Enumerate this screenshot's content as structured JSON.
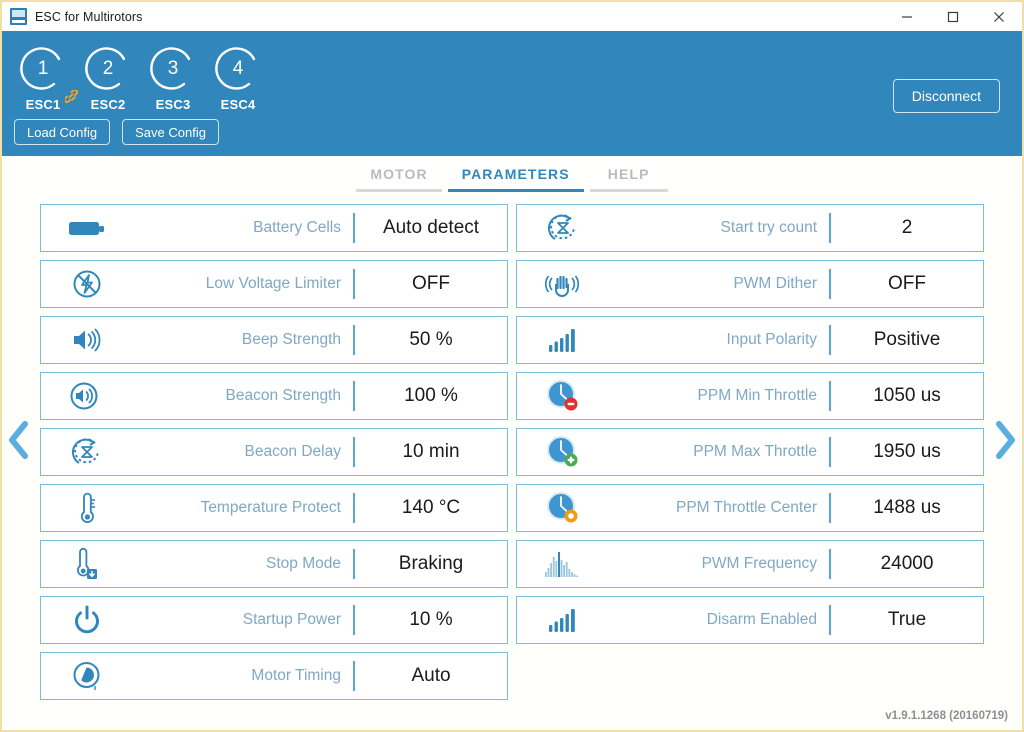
{
  "window": {
    "title": "ESC for Multirotors",
    "app_icon": "app-icon",
    "controls": {
      "minimize": "minimize-icon",
      "maximize": "maximize-icon",
      "close": "close-icon"
    }
  },
  "header": {
    "esc_units": [
      {
        "number": "1",
        "label": "ESC1",
        "linked": true
      },
      {
        "number": "2",
        "label": "ESC2",
        "linked": false
      },
      {
        "number": "3",
        "label": "ESC3",
        "linked": false
      },
      {
        "number": "4",
        "label": "ESC4",
        "linked": false
      }
    ],
    "load_config_label": "Load Config",
    "save_config_label": "Save Config",
    "disconnect_label": "Disconnect",
    "background_color": "#3187bc",
    "link_color": "#f0a030"
  },
  "tabs": [
    {
      "label": "MOTOR",
      "active": false
    },
    {
      "label": "PARAMETERS",
      "active": true
    },
    {
      "label": "HELP",
      "active": false
    }
  ],
  "nav": {
    "prev_icon": "chevron-left-icon",
    "next_icon": "chevron-right-icon",
    "arrow_color": "#5aaee0"
  },
  "parameters": {
    "left_column": [
      {
        "icon": "battery-icon",
        "label": "Battery Cells",
        "value": "Auto detect"
      },
      {
        "icon": "low-voltage-off-icon",
        "label": "Low Voltage Limiter",
        "value": "OFF"
      },
      {
        "icon": "speaker-beep-icon",
        "label": "Beep Strength",
        "value": "50 %"
      },
      {
        "icon": "speaker-beacon-icon",
        "label": "Beacon Strength",
        "value": "100 %"
      },
      {
        "icon": "hourglass-delay-icon",
        "label": "Beacon Delay",
        "value": "10 min"
      },
      {
        "icon": "thermometer-icon",
        "label": "Temperature Protect",
        "value": "140 °C"
      },
      {
        "icon": "thermometer-down-icon",
        "label": "Stop Mode",
        "value": "Braking"
      },
      {
        "icon": "power-icon",
        "label": "Startup Power",
        "value": "10 %"
      },
      {
        "icon": "motor-timing-icon",
        "label": "Motor Timing",
        "value": "Auto"
      }
    ],
    "right_column": [
      {
        "icon": "hourglass-retry-icon",
        "label": "Start try count",
        "value": "2"
      },
      {
        "icon": "hand-dither-icon",
        "label": "PWM Dither",
        "value": "OFF"
      },
      {
        "icon": "bars-up-icon",
        "label": "Input Polarity",
        "value": "Positive"
      },
      {
        "icon": "clock-minus-icon",
        "label": "PPM Min Throttle",
        "value": "1050 us"
      },
      {
        "icon": "clock-plus-icon",
        "label": "PPM Max Throttle",
        "value": "1950 us"
      },
      {
        "icon": "clock-center-icon",
        "label": "PPM Throttle Center",
        "value": "1488 us"
      },
      {
        "icon": "histogram-icon",
        "label": "PWM Frequency",
        "value": "24000"
      },
      {
        "icon": "bars-up-icon",
        "label": "Disarm Enabled",
        "value": "True"
      }
    ]
  },
  "footer": {
    "version": "v1.9.1.1268 (20160719)"
  },
  "colors": {
    "accent": "#3187bc",
    "row_border": "#7cbde0",
    "label_text": "#7fa8c4",
    "value_text": "#1b1b1b",
    "window_border": "#f0e0a8"
  }
}
